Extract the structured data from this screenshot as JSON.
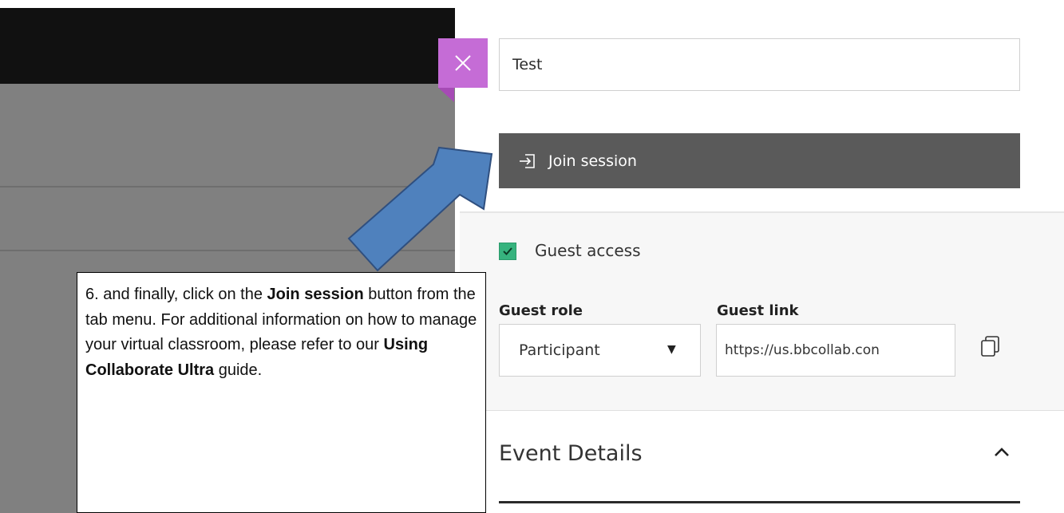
{
  "session": {
    "name_value": "Test",
    "join_button_label": "Join session"
  },
  "guest": {
    "access_label": "Guest access",
    "access_checked": true,
    "role_label": "Guest role",
    "role_value": "Participant",
    "link_label": "Guest link",
    "link_value": "https://us.bbcollab.con"
  },
  "event": {
    "title": "Event Details"
  },
  "callout": {
    "intro": "6. and finally, click on the ",
    "bold1": "Join session",
    "mid": " button from the tab menu.   For additional information on how to manage your virtual classroom, please refer to our ",
    "bold2": "Using Collaborate Ultra",
    "end": " guide."
  },
  "colors": {
    "close_button": "#c56cd6",
    "join_button": "#5a5a5a",
    "checkbox": "#36b37e",
    "arrow_fill": "#4f81bd",
    "arrow_stroke": "#2f4f7f"
  },
  "icons": {
    "close": "close-icon",
    "join": "enter-icon",
    "check": "check-icon",
    "dropdown": "caret-down-icon",
    "copy": "copy-icon",
    "collapse": "chevron-up-icon"
  }
}
